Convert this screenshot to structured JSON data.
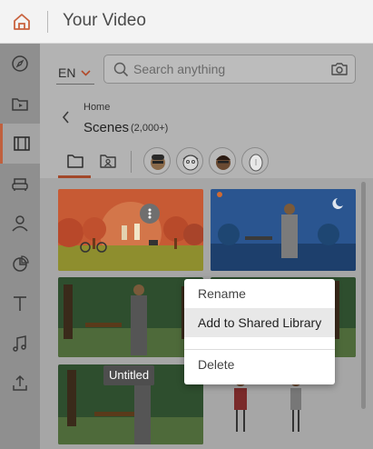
{
  "header": {
    "title": "Your Video",
    "home_icon": "home-icon"
  },
  "sidebar": {
    "items": [
      {
        "name": "compass-icon"
      },
      {
        "name": "media-folder-icon"
      },
      {
        "name": "film-icon",
        "active": true
      },
      {
        "name": "sofa-icon"
      },
      {
        "name": "person-icon"
      },
      {
        "name": "pie-chart-icon"
      },
      {
        "name": "text-icon"
      },
      {
        "name": "music-icon"
      },
      {
        "name": "upload-icon"
      }
    ]
  },
  "toolbar": {
    "language": "EN",
    "search": {
      "placeholder": "Search anything",
      "value": ""
    }
  },
  "library": {
    "breadcrumb": "Home",
    "title": "Scenes",
    "count": "(2,000+)",
    "tabs": [
      "folder-icon",
      "user-folder-icon"
    ],
    "characters": [
      "character-avatar-1",
      "character-avatar-2",
      "character-avatar-3",
      "character-avatar-4"
    ]
  },
  "tooltip": "Untitled",
  "context_menu": {
    "items": [
      {
        "label": "Rename"
      },
      {
        "label": "Add to Shared Library",
        "highlighted": true
      },
      {
        "label": "Delete"
      }
    ]
  },
  "colors": {
    "accent": "#c0603e",
    "orange_scene": "#d15a2e",
    "blue_scene": "#2c5a96",
    "forest_scene": "#2f5530"
  }
}
